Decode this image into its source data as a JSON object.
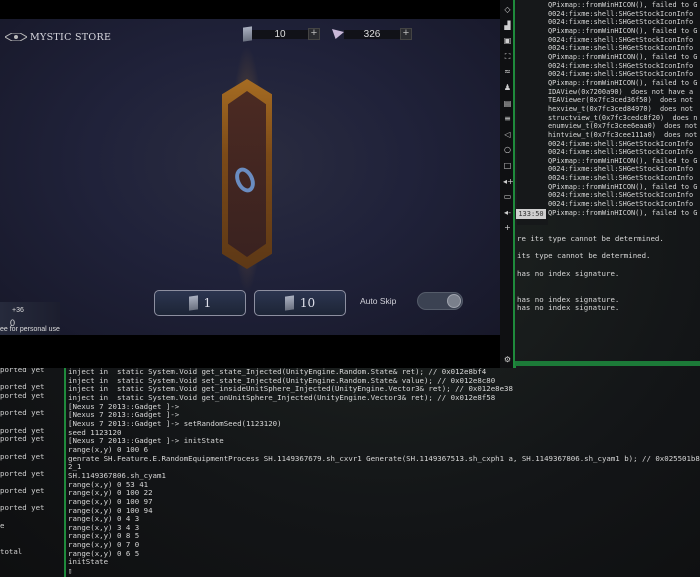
{
  "game": {
    "title": "MYSTIC STORE",
    "tickets": "10",
    "gems": "326",
    "plus": "+",
    "pull_one": "1",
    "pull_ten": "10",
    "auto_skip": "Auto Skip",
    "auto_skip_on": true,
    "bonus": "+36",
    "count": "0",
    "watermark": "ee for personal use"
  },
  "toolbar": {
    "icons": [
      "rotate-icon",
      "volume-icon",
      "screenshot-icon",
      "fullscreen-icon",
      "wifi-icon",
      "location-icon",
      "film-icon",
      "settings-slider-icon",
      "back-icon",
      "home-icon",
      "recents-icon",
      "volume-up-icon",
      "keyboard-icon",
      "volume-down-icon",
      "more-icon",
      "gear-icon"
    ]
  },
  "log_top": {
    "lines": [
      "QPixmap::fromWinHICON(), failed to G",
      "0024:fixme:shell:SHGetStockIconInfo",
      "0024:fixme:shell:SHGetStockIconInfo",
      "QPixmap::fromWinHICON(), failed to G",
      "0024:fixme:shell:SHGetStockIconInfo",
      "0024:fixme:shell:SHGetStockIconInfo",
      "QPixmap::fromWinHICON(), failed to G",
      "0024:fixme:shell:SHGetStockIconInfo",
      "0024:fixme:shell:SHGetStockIconInfo",
      "QPixmap::fromWinHICON(), failed to G",
      "IDAView(0x7200a90)  does not have a",
      "TEAViewer(0x7fc3ced36f50)  does not",
      "hexview_t(0x7fc3ced84970)  does not",
      "structview_t(0x7fc3cedc8f20)  does n",
      "enumview_t(0x7fc3cee6eaa0)  does not",
      "hintview_t(0x7fc3cee111a0)  does not",
      "0024:fixme:shell:SHGetStockIconInfo",
      "0024:fixme:shell:SHGetStockIconInfo",
      "QPixmap::fromWinHICON(), failed to G",
      "0024:fixme:shell:SHGetStockIconInfo",
      "0024:fixme:shell:SHGetStockIconInfo",
      "QPixmap::fromWinHICON(), failed to G",
      "0024:fixme:shell:SHGetStockIconInfo",
      "0024:fixme:shell:SHGetStockIconInfo",
      "QPixmap::fromWinHICON(), failed to G"
    ],
    "timestamp": "133:50"
  },
  "right_panel": {
    "lines": [
      "re its type cannot be determined.",
      "",
      "its type cannot be determined.",
      "",
      "has no index signature.",
      "",
      "",
      "has no index signature.",
      "has no index signature."
    ]
  },
  "left_column": {
    "lines": [
      "ported yet",
      "",
      "ported yet",
      "ported yet",
      "",
      "ported yet",
      "",
      "ported yet",
      "ported yet",
      "",
      "ported yet",
      "",
      "ported yet",
      "",
      "ported yet",
      "",
      "ported yet",
      "",
      "e",
      "",
      "",
      "total"
    ]
  },
  "terminal": {
    "lines": [
      "inject in  static System.Void get_state_Injected(UnityEngine.Random.State& ret); // 0x012e8bf4",
      "inject in  static System.Void set_state_Injected(UnityEngine.Random.State& value); // 0x012e8c80",
      "inject in  static System.Void get_insideUnitSphere_Injected(UnityEngine.Vector3& ret); // 0x012e8e38",
      "inject in  static System.Void get_onUnitSphere_Injected(UnityEngine.Vector3& ret); // 0x012e8f58",
      "[Nexus 7 2013::Gadget ]->",
      "[Nexus 7 2013::Gadget ]->",
      "[Nexus 7 2013::Gadget ]-> setRandomSeed(1123120)",
      "seed 1123120",
      "[Nexus 7 2013::Gadget ]-> initState",
      "range(x,y) 0 100 6",
      "genrate SH.Feature.E.RandomEquipmentProcess SH.1149367679.sh_cxvr1 Generate(SH.1149367513.sh_cxph1 a, SH.1149367806.sh_cyam1 b); // 0x025501b8",
      "2_1",
      "SH.1149367806.sh_cyam1",
      "range(x,y) 0 53 41",
      "range(x,y) 0 100 22",
      "range(x,y) 0 100 97",
      "range(x,y) 0 100 94",
      "range(x,y) 0 4 3",
      "range(x,y) 3 4 3",
      "range(x,y) 0 8 5",
      "range(x,y) 0 7 0",
      "range(x,y) 0 6 5",
      "initState",
      "▯"
    ]
  }
}
